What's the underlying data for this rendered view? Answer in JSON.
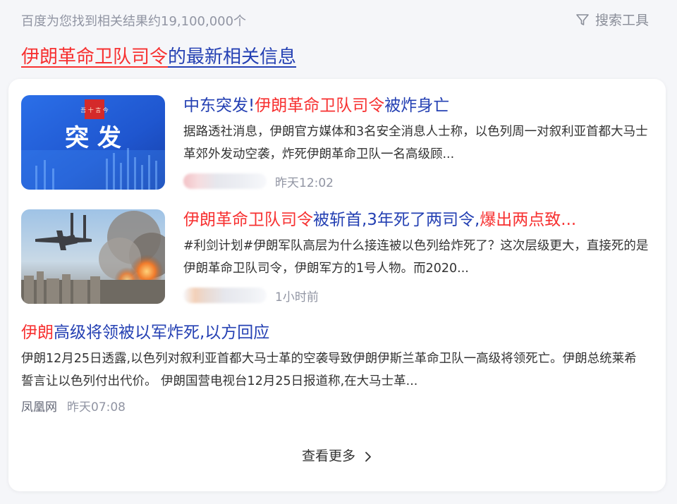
{
  "header": {
    "result_count": "百度为您找到相关结果约19,100,000个",
    "tools_label": "搜索工具",
    "tools_icon": "filter-icon"
  },
  "headline": {
    "highlight": "伊朗革命卫队司令",
    "rest": "的最新相关信息"
  },
  "results": [
    {
      "title_pre": "中东突发!",
      "title_hl": "伊朗革命卫队司令",
      "title_post": "被炸身亡",
      "summary": "据路透社消息，伊朗官方媒体和3名安全消息人士称，以色列周一对叙利亚首都大马士革郊外发动空袭，炸死伊朗革命卫队一名高级顾...",
      "time": "昨天12:02",
      "thumb_text": "突 发",
      "thumb_logo": "吾 十 言 今"
    },
    {
      "title_hl": "伊朗革命卫队司令",
      "title_mid": "被斩首,3年死了两司令,",
      "title_hl2": "爆出两点致...",
      "summary": "#利剑计划#伊朗军队高层为什么接连被以色列给炸死了？这次层级更大，直接死的是伊朗革命卫队司令，伊朗军方的1号人物。而2020...",
      "time": "1小时前"
    },
    {
      "title_hl": "伊朗",
      "title_post": "高级将领被以军炸死,以方回应",
      "summary": "伊朗12月25日透露,以色列对叙利亚首都大马士革的空袭导致伊朗伊斯兰革命卫队一高级将领死亡。伊朗总统莱希誓言让以色列付出代价。 伊朗国营电视台12月25日报道称,在大马士革...",
      "source": "凤凰网",
      "time": "昨天07:08"
    }
  ],
  "more": {
    "label": "查看更多",
    "icon": "chevron-right-icon"
  },
  "colors": {
    "link": "#2440b3",
    "highlight": "#f73131",
    "muted": "#9195a3"
  }
}
